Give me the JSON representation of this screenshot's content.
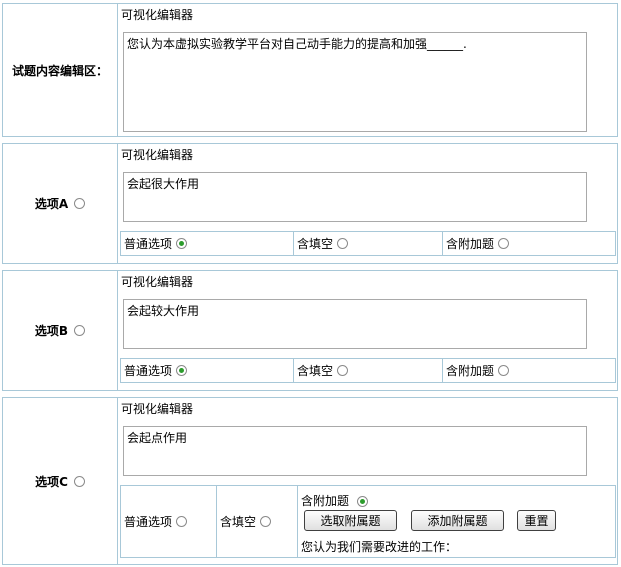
{
  "editor_label": "可视化编辑器",
  "question": {
    "label": "试题内容编辑区：",
    "content": "您认为本虚拟实验教学平台对自己动手能力的提高和加强______."
  },
  "options": [
    {
      "label": "选项A",
      "content": "会起很大作用",
      "types": [
        "普通选项",
        "含填空",
        "含附加题"
      ]
    },
    {
      "label": "选项B",
      "content": "会起较大作用",
      "types": [
        "普通选项",
        "含填空",
        "含附加题"
      ]
    },
    {
      "label": "选项C",
      "content": "会起点作用",
      "types": [
        "普通选项",
        "含填空",
        "含附加题"
      ]
    }
  ],
  "option_c_extra": {
    "select_button": "选取附属题",
    "add_button": "添加附属题",
    "reset_button": "重置",
    "attached_question": "您认为我们需要改进的工作："
  }
}
